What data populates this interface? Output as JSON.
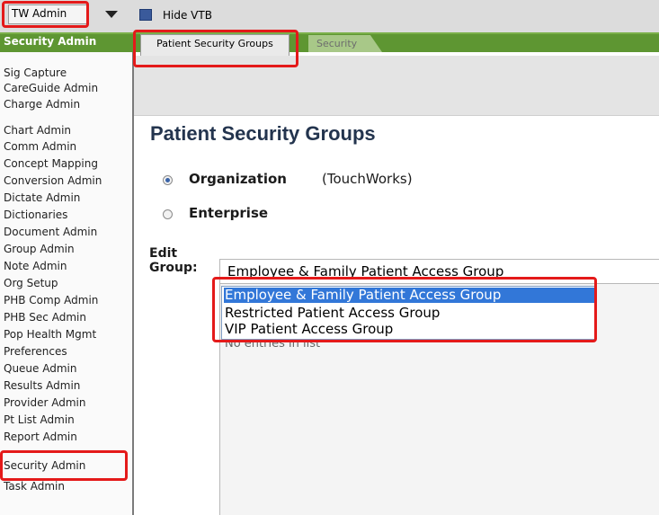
{
  "app_switcher": {
    "label": "TW Admin"
  },
  "toolbar_top": {
    "hide_vtb_label": "Hide VTB"
  },
  "module_title": "Security Admin",
  "tabs": [
    {
      "label": "Patient Security Groups",
      "active": true
    },
    {
      "label": "Security",
      "active": false
    }
  ],
  "sidebar": {
    "items": [
      {
        "label": "Sig Capture"
      },
      {
        "label": "CareGuide Admin"
      },
      {
        "label": "Charge Admin"
      },
      {
        "label": "Chart Admin"
      },
      {
        "label": "Comm Admin"
      },
      {
        "label": "Concept Mapping"
      },
      {
        "label": "Conversion Admin"
      },
      {
        "label": "Dictate Admin"
      },
      {
        "label": "Dictionaries"
      },
      {
        "label": "Document Admin"
      },
      {
        "label": "Group Admin"
      },
      {
        "label": "Note Admin"
      },
      {
        "label": "Org Setup"
      },
      {
        "label": "PHB Comp Admin"
      },
      {
        "label": "PHB Sec Admin"
      },
      {
        "label": "Pop Health Mgmt"
      },
      {
        "label": "Preferences"
      },
      {
        "label": "Queue Admin"
      },
      {
        "label": "Results Admin"
      },
      {
        "label": "Provider Admin"
      },
      {
        "label": "Pt List Admin"
      },
      {
        "label": "Report Admin"
      },
      {
        "label": "Security Admin",
        "selected": true
      },
      {
        "label": "Task Admin"
      }
    ]
  },
  "main": {
    "title": "Patient Security Groups",
    "scope": {
      "organization_label": "Organization",
      "organization_note": "(TouchWorks)",
      "enterprise_label": "Enterprise",
      "selected": "Organization"
    },
    "edit_group": {
      "label_line1": "Edit",
      "label_line2": "Group:",
      "selected_value": "Employee & Family Patient Access Group",
      "options": [
        "Employee & Family Patient Access Group",
        "Restricted Patient Access Group",
        "VIP Patient Access Group"
      ]
    },
    "list_empty_text": "No entries in list"
  },
  "colors": {
    "accent_green": "#5e9632",
    "title_navy": "#23344e",
    "selection_blue": "#3277d8",
    "annotation_red": "#e41a1a"
  }
}
